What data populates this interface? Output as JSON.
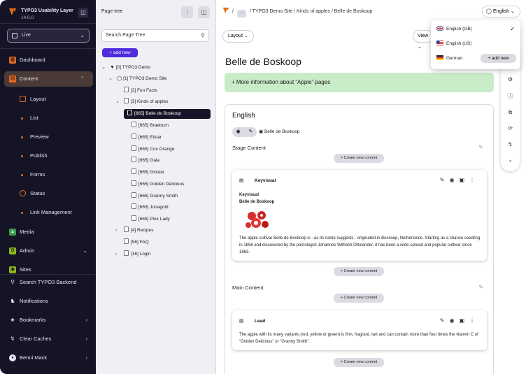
{
  "app": {
    "title": "TYPO3 Usability Layer",
    "version": "14.0.0"
  },
  "workspace": {
    "value": "Live"
  },
  "colors": {
    "accent": "#e66d1c",
    "primary": "#4e2bdc",
    "sidebar": "#151427",
    "info_bg": "#c8ecc8"
  },
  "nav": {
    "dashboard": "Dashboard",
    "content": "Content",
    "content_sub": [
      "Layout",
      "List",
      "Preview",
      "Publish",
      "Forms",
      "Status",
      "Link Management"
    ],
    "media": "Media",
    "admin": "Admin",
    "sites": "Sites"
  },
  "bottom_nav": [
    "Search TYPO3 Backend",
    "Notifications",
    "Bookmarks",
    "Clear Caches",
    "Benni Mack"
  ],
  "tree": {
    "header": "Page tree",
    "search_placeholder": "Search Page Tree",
    "add_new": "add new",
    "nodes": [
      "[0] TYPO3 Demo",
      "[1] TYPO3 Demo Site",
      "[2] Fun Facts",
      "[3] Kinds of apples",
      "[665] Belle de Boskoop",
      "[665] Braeburn",
      "[665] Elstar",
      "[665] Cox Orange",
      "[665] Gala",
      "[665] Gloster",
      "[665] Golden Delicious",
      "[665] Granny Smith",
      "[665] Jonagold",
      "[665] Pink Lady",
      "[4] Recipes",
      "[56] FAQ",
      "[16] Login"
    ]
  },
  "breadcrumb": {
    "dots": "···",
    "items": [
      "TYPO3 Demo Site",
      "Kinds of apples",
      "Belle de Boskoop"
    ],
    "sep": "/"
  },
  "language": {
    "current": "English",
    "options": [
      "English (GB)",
      "English (US)",
      "German"
    ],
    "add_new": "add new"
  },
  "toolbar": {
    "layout": "Layout",
    "view": "View"
  },
  "page": {
    "title": "Belle de Boskoop",
    "info": "More information about “Apple” pages",
    "lang_heading": "English",
    "page_label": "Belle de Boskoop",
    "stage": "Stage Content",
    "main": "Main Content",
    "create_new": "Create new content"
  },
  "elements": {
    "keyvisual": {
      "type": "Keyvisual",
      "heading1": "Keyvisual",
      "heading2": "Belle de Boskoop",
      "text": "The apple cultivar Belle de Boskoop is - as its name suggests - originated in Boskoop, Netherlands. Starting as a chance seedling in 1856 and discovered by the pomologist Johannes Wilhelm Ottolander, it has been a wide-spread and popular cultivar since 1863."
    },
    "lead": {
      "type": "Lead",
      "text": "The apple with its many variants (red, yellow or green) is firm, fragrant, tart and can contain more than four times the vitamin C of \"Golden Delicious\" or \"Granny Smith\"."
    }
  }
}
